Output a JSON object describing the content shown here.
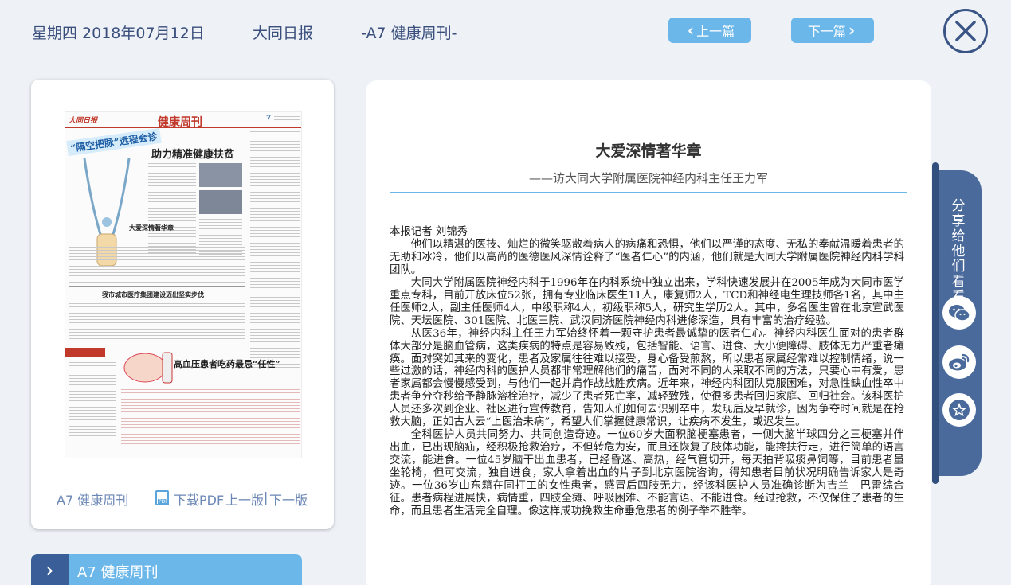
{
  "header": {
    "date": "星期四 2018年07月12日",
    "paper": "大同日报",
    "section": "-A7 健康周刊-",
    "prev_label": "上一篇",
    "next_label": "下一篇"
  },
  "page_card": {
    "section_label": "A7 健康周刊",
    "pdf_label": "下载PDF",
    "prev_page_label": "上一版",
    "separator": "|",
    "next_page_label": "下一版"
  },
  "section_tab": {
    "label": "A7 健康周刊"
  },
  "article": {
    "title": "大爱深情著华章",
    "subtitle": "——访大同大学附属医院神经内科主任王力军",
    "byline": "本报记者 刘锦秀",
    "paragraphs": [
      "他们以精湛的医技、灿烂的微笑驱散着病人的病痛和恐惧，他们以严谨的态度、无私的奉献温暖着患者的无助和冰冷，他们以高尚的医德医风深情诠释了“医者仁心”的内涵，他们就是大同大学附属医院神经内科学科团队。",
      "大同大学附属医院神经内科于1996年在内科系统中独立出来，学科快速发展并在2005年成为大同市医学重点专科，目前开放床位52张，拥有专业临床医生11人，康复师2人，TCD和神经电生理技师各1名，其中主任医师2人，副主任医师4人，中级职称4人，初级职称5人，研究生学历2人。其中，多名医生曾在北京宣武医院、天坛医院、301医院、北医三院、武汉同济医院神经内科进修深造，具有丰富的治疗经验。",
      "从医36年，神经内科主任王力军始终怀着一颗守护患者最诚挚的医者仁心。神经内科医生面对的患者群体大部分是脑血管病，这类疾病的特点是容易致残，包括智能、语言、进食、大小便障碍、肢体无力严重者瘫痪。面对突如其来的变化，患者及家属往往难以接受，身心备受煎熬，所以患者家属经常难以控制情绪，说一些过激的话，神经内科的医护人员都非常理解他们的痛苦，面对不同的人采取不同的方法，只要心中有爱，患者家属都会慢慢感受到，与他们一起并肩作战战胜疾病。近年来，神经内科团队克服困难，对急性缺血性卒中患者争分夺秒给予静脉溶栓治疗，减少了患者死亡率，减轻致残，使很多患者回归家庭、回归社会。该科医护人员还多次到企业、社区进行宣传教育，告知人们如何去识别卒中，发现后及早就诊，因为争夺时间就是在抢救大脑，正如古人云“上医治未病”，希望人们掌握健康常识，让疾病不发生，或迟发生。",
      "全科医护人员共同努力、共同创造奇迹。一位60岁大面积脑梗塞患者，一侧大脑半球四分之三梗塞并伴出血，已出现脑疝，经积极抢救治疗，不但转危为安，而且还恢复了肢体功能，能搀扶行走，进行简单的语言交流，能进食。一位45岁脑干出血患者，已经昏迷、高热，经气管切开，每天拍背吸痰鼻饲等，目前患者虽坐轮椅，但可交流，独自进食，家人拿着出血的片子到北京医院咨询，得知患者目前状况明确告诉家人是奇迹。一位36岁山东籍在同打工的女性患者，感冒后四肢无力，经该科医护人员准确诊断为吉兰—巴雷综合征。患者病程进展快，病情重，四肢全瘫、呼吸困难、不能言语、不能进食。经过抢救，不仅保住了患者的生命，而且患者生活完全自理。像这样成功挽救生命垂危患者的例子举不胜举。"
    ]
  },
  "thumbnail": {
    "masthead": "大同日报",
    "page_title": "健康周刊",
    "page_number": "7",
    "headline_banner": "“隔空把脉”远程会诊",
    "headline_1": "助力精准健康扶贫",
    "headline_2": "大爱深情著华章",
    "headline_3": "我市城市医疗集团建设迈出坚实步伐",
    "headline_4": "高血压患者吃药最忌“任性”"
  },
  "share": {
    "label": "分享给他们看看",
    "items": [
      "wechat",
      "weibo",
      "favorite"
    ]
  },
  "colors": {
    "accent": "#6cb7ea",
    "navy": "#3a5f98",
    "background": "#eef2f7"
  }
}
